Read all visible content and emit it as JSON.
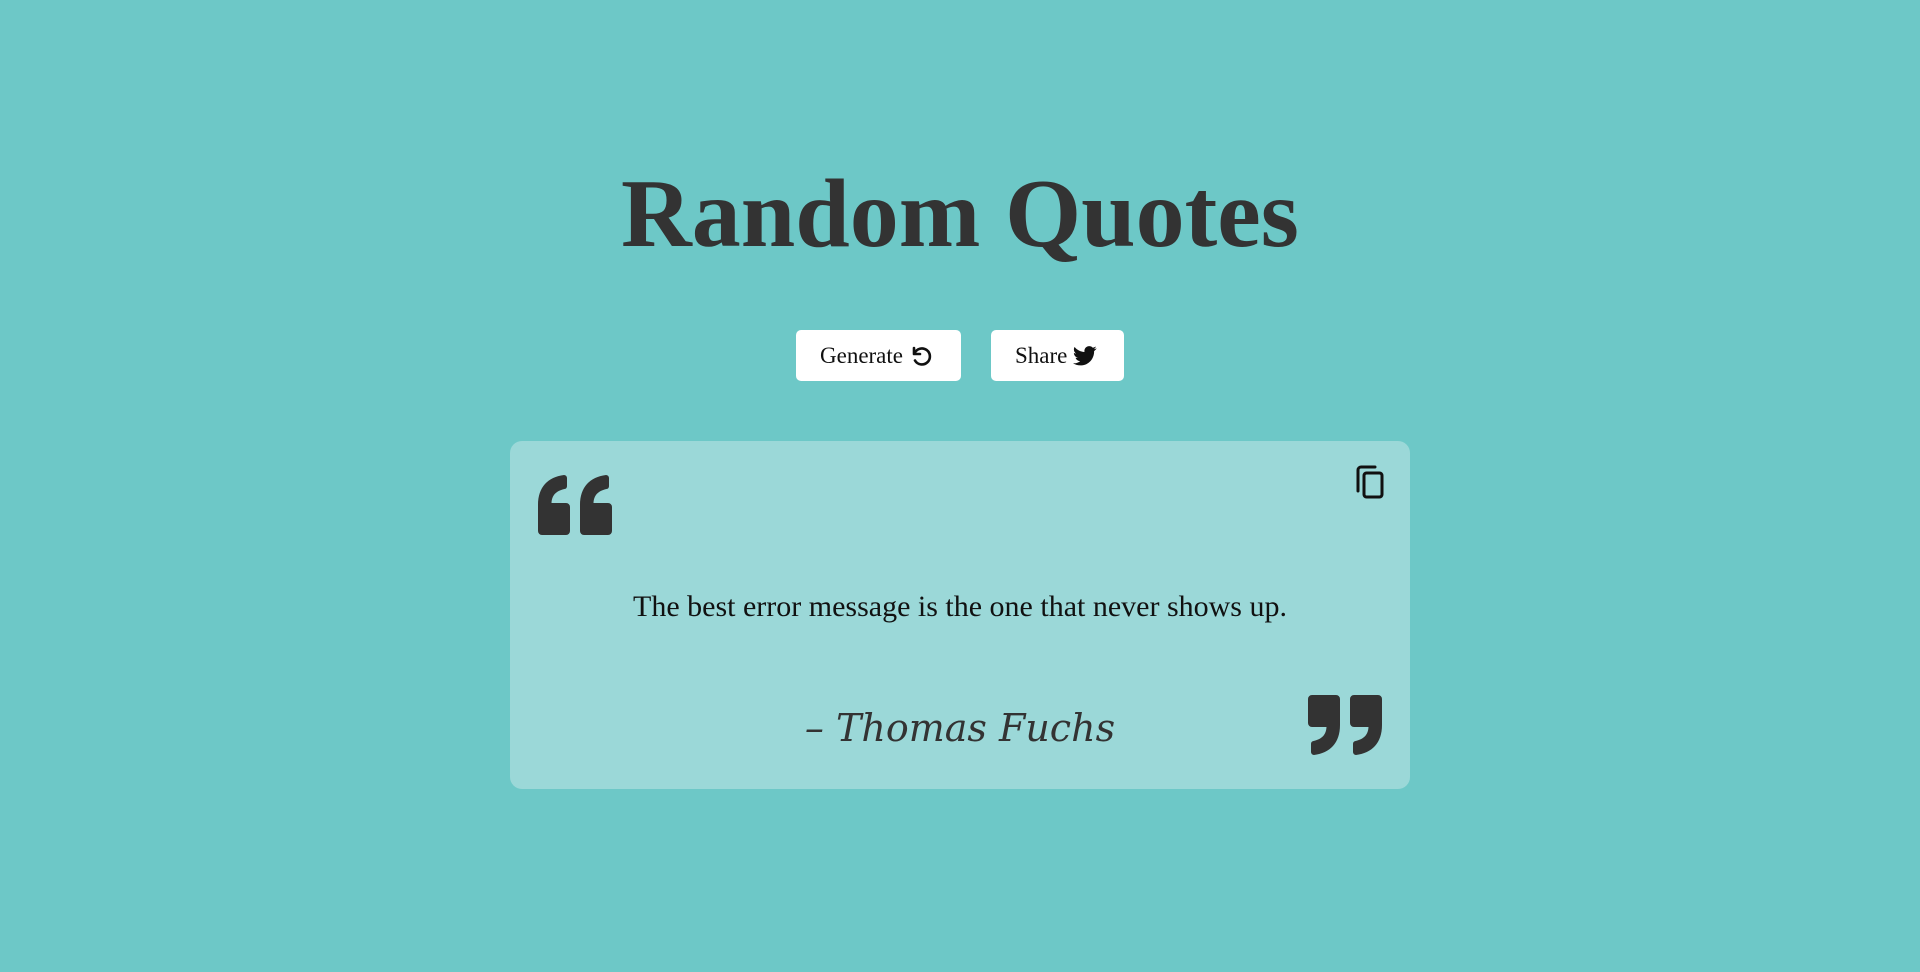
{
  "title": "Random Quotes",
  "buttons": {
    "generate_label": "Generate",
    "generate_icon": "rotate-left-icon",
    "share_label": "Share",
    "share_icon": "twitter-bird-icon"
  },
  "quote": {
    "text": "The best error message is the one that never shows up.",
    "author": "– Thomas Fuchs",
    "copy_icon": "copy-icon",
    "open_quote_icon": "open-quote-icon",
    "close_quote_icon": "close-quote-icon"
  },
  "colors": {
    "background": "#6dc8c7",
    "card": "#9bd8d8",
    "text_dark": "#333333",
    "button_bg": "#ffffff"
  }
}
